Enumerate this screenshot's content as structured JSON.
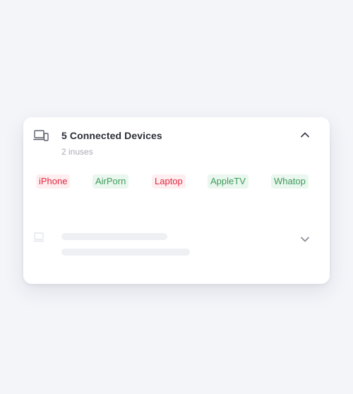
{
  "card": {
    "title": "5 Connected Devices",
    "subtitle": "2 inuses",
    "devices": [
      {
        "label": "iPhone",
        "status": "red"
      },
      {
        "label": "AirPorn",
        "status": "green"
      },
      {
        "label": "Laptop",
        "status": "red"
      },
      {
        "label": "AppleTV",
        "status": "green"
      },
      {
        "label": "Whatop",
        "status": "green"
      }
    ]
  },
  "colors": {
    "title": "#2c2f38",
    "subtitle": "#a8abb4",
    "chip_red_text": "#e0283f",
    "chip_red_bg": "#ffeef0",
    "chip_green_text": "#3f9a5c",
    "chip_green_bg": "#eaf7ee",
    "background": "#f4f5f9"
  },
  "icons": {
    "primary": "laptop-phone-icon",
    "expanded": "chevron-up-icon",
    "collapsed": "chevron-down-icon"
  }
}
